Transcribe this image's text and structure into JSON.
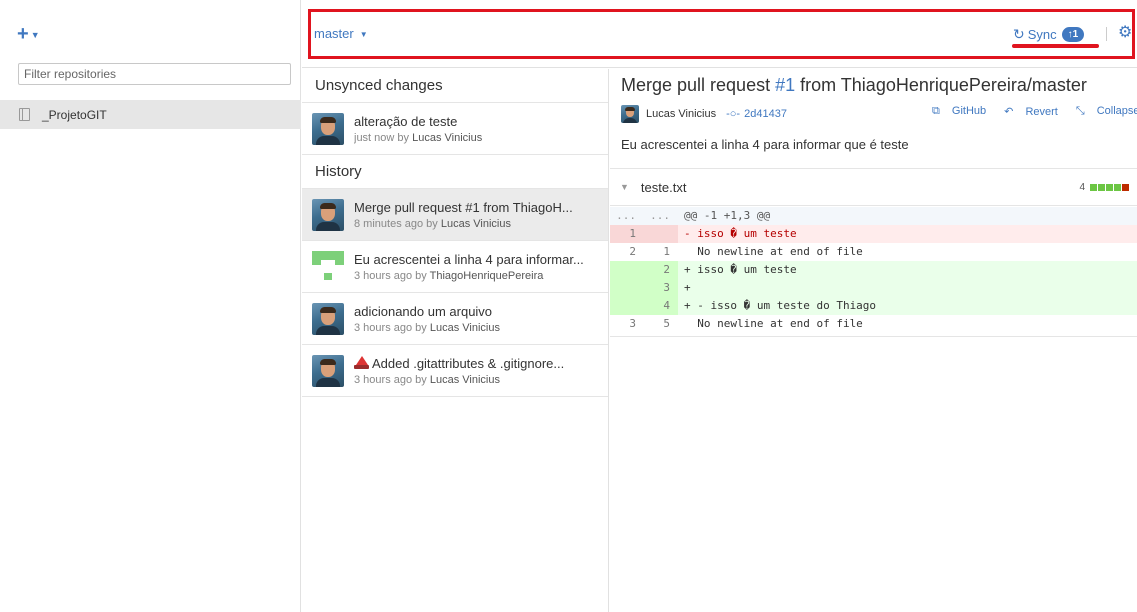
{
  "sidebar": {
    "add_label": "+",
    "filter_placeholder": "Filter repositories",
    "repos": [
      {
        "name": "_ProjetoGIT"
      }
    ]
  },
  "topbar": {
    "branch": "master",
    "sync_label": "Sync",
    "sync_badge": "1",
    "accent_color": "#4078c0",
    "annotation_color": "#e0141f"
  },
  "middle": {
    "unsynced_header": "Unsynced changes",
    "unsynced": [
      {
        "title": "alteração de teste",
        "time": "just now by",
        "author": "Lucas Vinicius",
        "avatar": "user-avatar"
      }
    ],
    "history_header": "History",
    "history": [
      {
        "title": "Merge pull request #1 from ThiagoH...",
        "time": "8 minutes ago by",
        "author": "Lucas Vinicius",
        "avatar": "user-avatar"
      },
      {
        "title": "Eu acrescentei a linha 4 para informar...",
        "time": "3 hours ago by",
        "author": "ThiagoHenriquePereira",
        "avatar": "identicon"
      },
      {
        "title": "adicionando um arquivo",
        "time": "3 hours ago by",
        "author": "Lucas Vinicius",
        "avatar": "user-avatar"
      },
      {
        "title": "Added .gitattributes & .gitignore...",
        "time": "3 hours ago by",
        "author": "Lucas Vinicius",
        "avatar": "user-avatar"
      }
    ]
  },
  "detail": {
    "title_prefix": "Merge pull request ",
    "title_pr": "#1",
    "title_suffix": " from ThiagoHenriquePereira/master",
    "author": "Lucas Vinicius",
    "sha": "2d41437",
    "actions": {
      "github": "GitHub",
      "revert": "Revert",
      "collapse": "Collapse all"
    },
    "description": "Eu acrescentei a linha 4 para informar que é teste",
    "file": {
      "name": "teste.txt",
      "changes": "4",
      "stat_colors": [
        "#6cc644",
        "#6cc644",
        "#6cc644",
        "#6cc644",
        "#bd2c00"
      ]
    },
    "diff": [
      {
        "type": "hunk",
        "old": "...",
        "new": "...",
        "text": "@@ -1 +1,3 @@"
      },
      {
        "type": "del",
        "old": "1",
        "new": "",
        "text": "- isso � um teste"
      },
      {
        "type": "ctx",
        "old": "2",
        "new": "1",
        "text": "  No newline at end of file"
      },
      {
        "type": "add",
        "old": "",
        "new": "2",
        "text": "+ isso � um teste"
      },
      {
        "type": "add",
        "old": "",
        "new": "3",
        "text": "+"
      },
      {
        "type": "add",
        "old": "",
        "new": "4",
        "text": "+ - isso � um teste do Thiago"
      },
      {
        "type": "ctx",
        "old": "3",
        "new": "5",
        "text": "  No newline at end of file"
      }
    ]
  }
}
